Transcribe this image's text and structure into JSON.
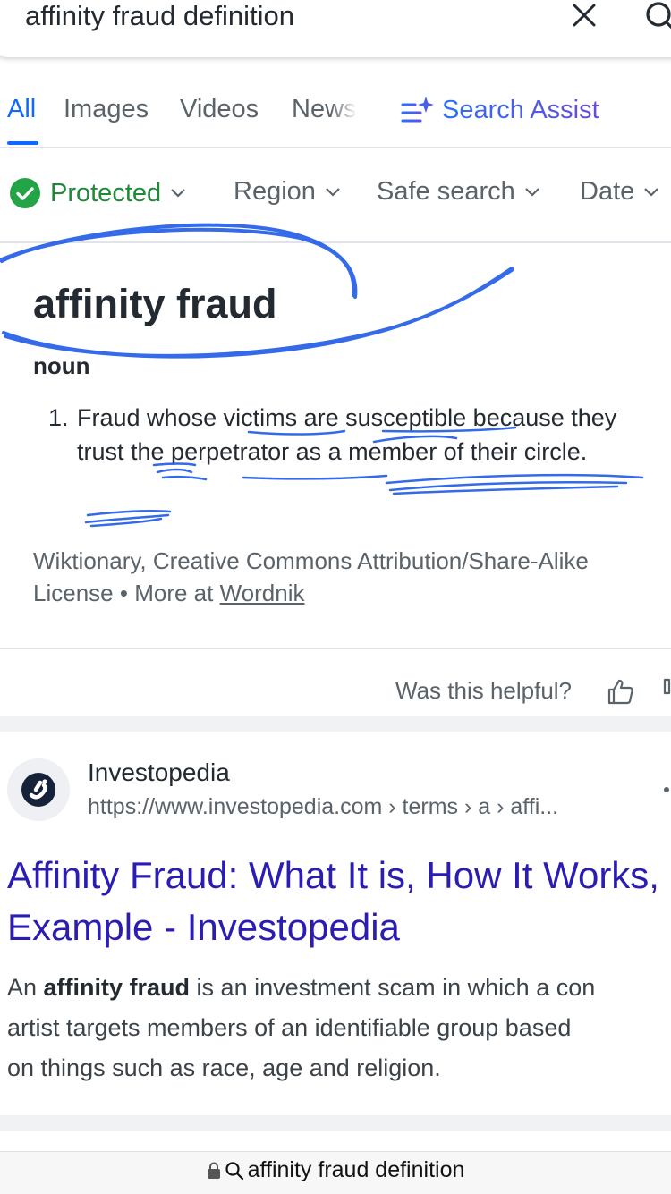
{
  "search": {
    "query": "affinity fraud definition"
  },
  "tabs": [
    {
      "label": "All",
      "active": true
    },
    {
      "label": "Images"
    },
    {
      "label": "Videos"
    },
    {
      "label": "News"
    }
  ],
  "search_assist": {
    "label": "Search Assist",
    "icon": "sparkle-list-icon"
  },
  "filters": {
    "protected": "Protected",
    "region": "Region",
    "safe_search": "Safe search",
    "date": "Date"
  },
  "definition": {
    "term": "affinity fraud",
    "part_of_speech": "noun",
    "items": [
      {
        "number": "1.",
        "text": "Fraud whose victims are susceptible because they trust the perpetrator as a member of their circle."
      }
    ],
    "source": "Wiktionary, Creative Commons Attribution/Share-Alike License",
    "separator": "•",
    "more_at": "More at",
    "more_link": "Wordnik"
  },
  "feedback": {
    "question": "Was this helpful?"
  },
  "result": {
    "site_name": "Investopedia",
    "url": "https://www.investopedia.com › terms › a › affi...",
    "title": "Affinity Fraud: What It is, How It Works, Example - Investopedia",
    "snippet": {
      "line1_prefix": "An ",
      "line1_bold": "affinity fraud",
      "line1_rest": " is an investment scam in which a con",
      "line2": "artist targets members of an identifiable group based",
      "line3": "on things such as race, age and religion."
    }
  },
  "address_bar": {
    "text": "affinity fraud definition"
  },
  "colors": {
    "accent": "#0f69ff",
    "protected_green": "#1f8a3a",
    "link": "#2b1db4",
    "annotation_ink": "#1f5ae6"
  }
}
